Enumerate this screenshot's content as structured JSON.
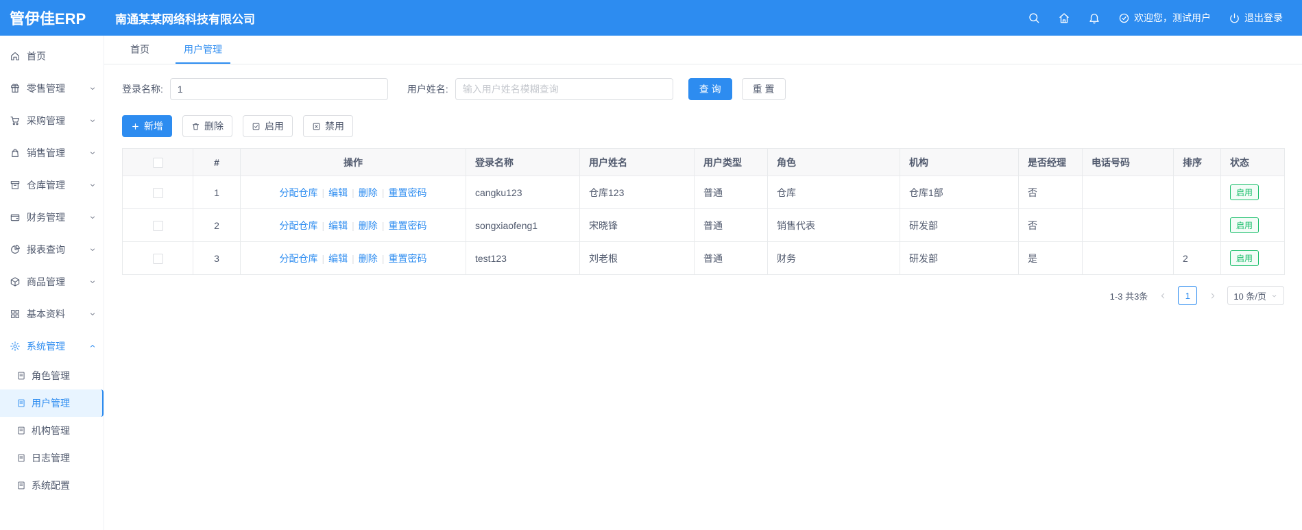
{
  "topbar": {
    "logo": "管伊佳ERP",
    "company": "南通某某网络科技有限公司",
    "welcome": "欢迎您，测试用户",
    "logout": "退出登录"
  },
  "tabs": {
    "home": "首页",
    "current": "用户管理"
  },
  "sidebar": {
    "items": [
      {
        "label": "首页"
      },
      {
        "label": "零售管理"
      },
      {
        "label": "采购管理"
      },
      {
        "label": "销售管理"
      },
      {
        "label": "仓库管理"
      },
      {
        "label": "财务管理"
      },
      {
        "label": "报表查询"
      },
      {
        "label": "商品管理"
      },
      {
        "label": "基本资料"
      },
      {
        "label": "系统管理"
      }
    ],
    "subitems": [
      {
        "label": "角色管理"
      },
      {
        "label": "用户管理"
      },
      {
        "label": "机构管理"
      },
      {
        "label": "日志管理"
      },
      {
        "label": "系统配置"
      }
    ]
  },
  "filters": {
    "login_label": "登录名称:",
    "login_value": "1",
    "name_label": "用户姓名:",
    "name_placeholder": "输入用户姓名模糊查询",
    "search_button": "查 询",
    "reset_button": "重 置"
  },
  "toolbar": {
    "add": "新增",
    "delete": "删除",
    "enable": "启用",
    "disable": "禁用"
  },
  "table": {
    "headers": [
      "#",
      "操作",
      "登录名称",
      "用户姓名",
      "用户类型",
      "角色",
      "机构",
      "是否经理",
      "电话号码",
      "排序",
      "状态"
    ],
    "op_links": [
      "分配仓库",
      "编辑",
      "删除",
      "重置密码"
    ],
    "op_separator": "|",
    "rows": [
      {
        "index": "1",
        "login": "cangku123",
        "name": "仓库123",
        "type": "普通",
        "role": "仓库",
        "org": "仓库1部",
        "manager": "否",
        "phone": "",
        "sort": "",
        "status": "启用"
      },
      {
        "index": "2",
        "login": "songxiaofeng1",
        "name": "宋晓锋",
        "type": "普通",
        "role": "销售代表",
        "org": "研发部",
        "manager": "否",
        "phone": "",
        "sort": "",
        "status": "启用"
      },
      {
        "index": "3",
        "login": "test123",
        "name": "刘老根",
        "type": "普通",
        "role": "财务",
        "org": "研发部",
        "manager": "是",
        "phone": "",
        "sort": "2",
        "status": "启用"
      }
    ]
  },
  "pagination": {
    "total": "1-3 共3条",
    "page": "1",
    "page_size": "10 条/页"
  },
  "colors": {
    "primary": "#2d8cf0",
    "success": "#19be6b"
  }
}
